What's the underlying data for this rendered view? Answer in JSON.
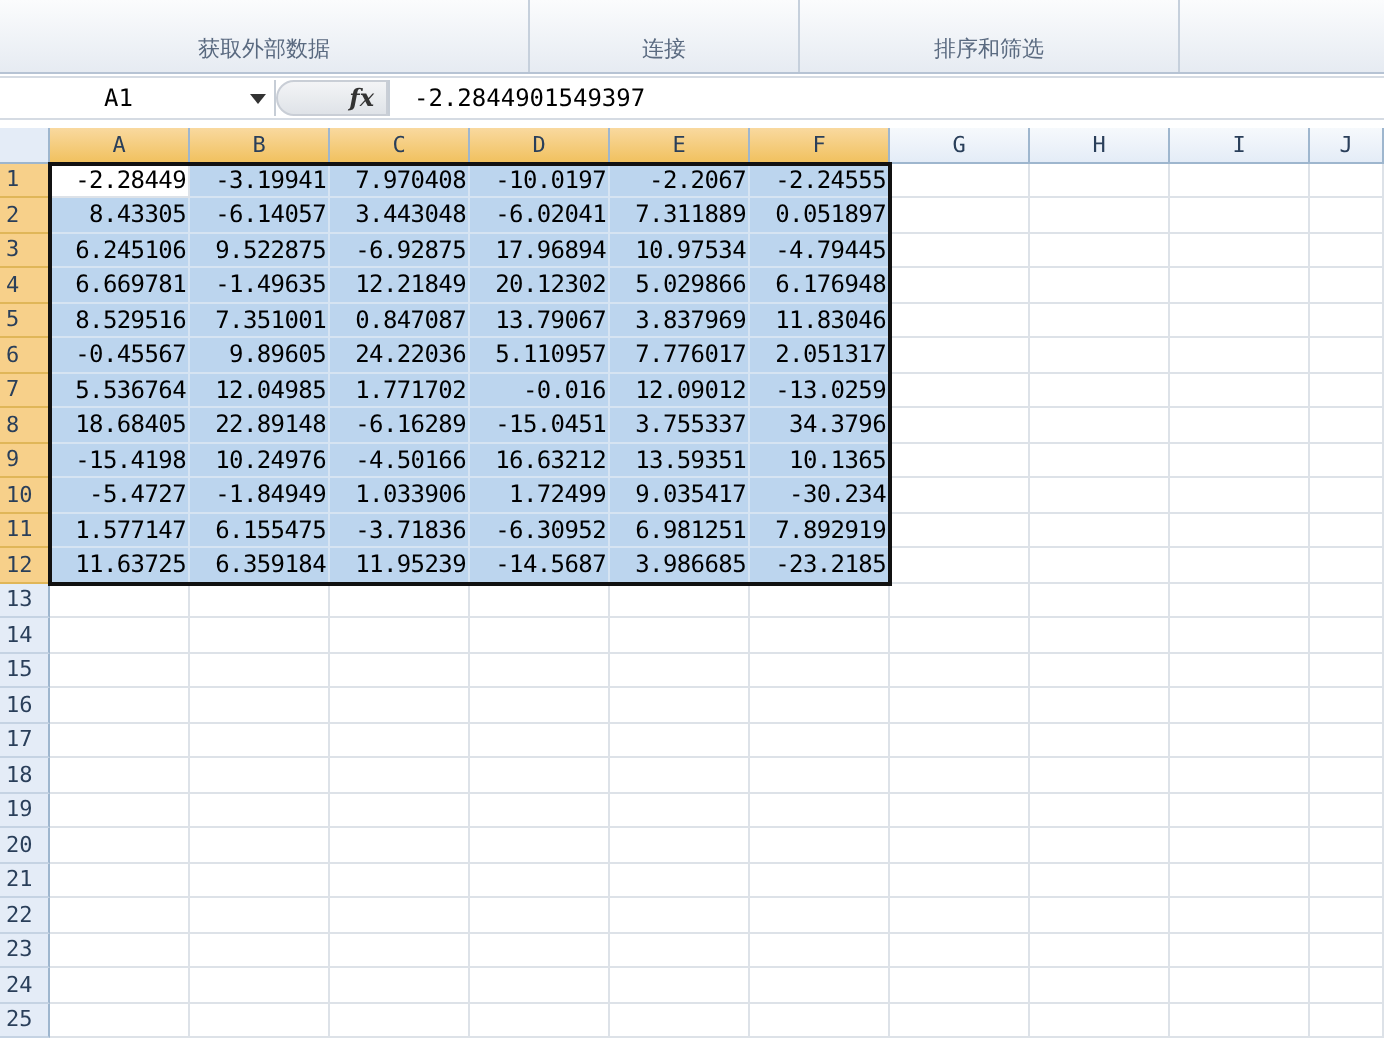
{
  "ribbon": {
    "groups": [
      {
        "label": "获取外部数据"
      },
      {
        "label": "连接"
      },
      {
        "label": "排序和筛选"
      }
    ]
  },
  "formula_bar": {
    "name_box": "A1",
    "function_button": "fx",
    "formula": "-2.2844901549397"
  },
  "columns": [
    {
      "label": "A",
      "selected": true
    },
    {
      "label": "B",
      "selected": true
    },
    {
      "label": "C",
      "selected": true
    },
    {
      "label": "D",
      "selected": true
    },
    {
      "label": "E",
      "selected": true
    },
    {
      "label": "F",
      "selected": true
    },
    {
      "label": "G",
      "selected": false
    },
    {
      "label": "H",
      "selected": false
    },
    {
      "label": "I",
      "selected": false
    },
    {
      "label": "J",
      "selected": false
    }
  ],
  "rows": [
    {
      "label": "1",
      "selected": true,
      "cells": [
        {
          "text": "-2.28449",
          "active": true
        },
        {
          "text": "-3.19941",
          "active": false
        },
        {
          "text": "7.970408",
          "active": false
        },
        {
          "text": "-10.0197",
          "active": false
        },
        {
          "text": "-2.2067",
          "active": false
        },
        {
          "text": "-2.24555",
          "active": false
        }
      ]
    },
    {
      "label": "2",
      "selected": true,
      "cells": [
        {
          "text": "8.43305",
          "active": false
        },
        {
          "text": "-6.14057",
          "active": false
        },
        {
          "text": "3.443048",
          "active": false
        },
        {
          "text": "-6.02041",
          "active": false
        },
        {
          "text": "7.311889",
          "active": false
        },
        {
          "text": "0.051897",
          "active": false
        }
      ]
    },
    {
      "label": "3",
      "selected": true,
      "cells": [
        {
          "text": "6.245106",
          "active": false
        },
        {
          "text": "9.522875",
          "active": false
        },
        {
          "text": "-6.92875",
          "active": false
        },
        {
          "text": "17.96894",
          "active": false
        },
        {
          "text": "10.97534",
          "active": false
        },
        {
          "text": "-4.79445",
          "active": false
        }
      ]
    },
    {
      "label": "4",
      "selected": true,
      "cells": [
        {
          "text": "6.669781",
          "active": false
        },
        {
          "text": "-1.49635",
          "active": false
        },
        {
          "text": "12.21849",
          "active": false
        },
        {
          "text": "20.12302",
          "active": false
        },
        {
          "text": "5.029866",
          "active": false
        },
        {
          "text": "6.176948",
          "active": false
        }
      ]
    },
    {
      "label": "5",
      "selected": true,
      "cells": [
        {
          "text": "8.529516",
          "active": false
        },
        {
          "text": "7.351001",
          "active": false
        },
        {
          "text": "0.847087",
          "active": false
        },
        {
          "text": "13.79067",
          "active": false
        },
        {
          "text": "3.837969",
          "active": false
        },
        {
          "text": "11.83046",
          "active": false
        }
      ]
    },
    {
      "label": "6",
      "selected": true,
      "cells": [
        {
          "text": "-0.45567",
          "active": false
        },
        {
          "text": "9.89605",
          "active": false
        },
        {
          "text": "24.22036",
          "active": false
        },
        {
          "text": "5.110957",
          "active": false
        },
        {
          "text": "7.776017",
          "active": false
        },
        {
          "text": "2.051317",
          "active": false
        }
      ]
    },
    {
      "label": "7",
      "selected": true,
      "cells": [
        {
          "text": "5.536764",
          "active": false
        },
        {
          "text": "12.04985",
          "active": false
        },
        {
          "text": "1.771702",
          "active": false
        },
        {
          "text": "-0.016",
          "active": false
        },
        {
          "text": "12.09012",
          "active": false
        },
        {
          "text": "-13.0259",
          "active": false
        }
      ]
    },
    {
      "label": "8",
      "selected": true,
      "cells": [
        {
          "text": "18.68405",
          "active": false
        },
        {
          "text": "22.89148",
          "active": false
        },
        {
          "text": "-6.16289",
          "active": false
        },
        {
          "text": "-15.0451",
          "active": false
        },
        {
          "text": "3.755337",
          "active": false
        },
        {
          "text": "34.3796",
          "active": false
        }
      ]
    },
    {
      "label": "9",
      "selected": true,
      "cells": [
        {
          "text": "-15.4198",
          "active": false
        },
        {
          "text": "10.24976",
          "active": false
        },
        {
          "text": "-4.50166",
          "active": false
        },
        {
          "text": "16.63212",
          "active": false
        },
        {
          "text": "13.59351",
          "active": false
        },
        {
          "text": "10.1365",
          "active": false
        }
      ]
    },
    {
      "label": "10",
      "selected": true,
      "cells": [
        {
          "text": "-5.4727",
          "active": false
        },
        {
          "text": "-1.84949",
          "active": false
        },
        {
          "text": "1.033906",
          "active": false
        },
        {
          "text": "1.72499",
          "active": false
        },
        {
          "text": "9.035417",
          "active": false
        },
        {
          "text": "-30.234",
          "active": false
        }
      ]
    },
    {
      "label": "11",
      "selected": true,
      "cells": [
        {
          "text": "1.577147",
          "active": false
        },
        {
          "text": "6.155475",
          "active": false
        },
        {
          "text": "-3.71836",
          "active": false
        },
        {
          "text": "-6.30952",
          "active": false
        },
        {
          "text": "6.981251",
          "active": false
        },
        {
          "text": "7.892919",
          "active": false
        }
      ]
    },
    {
      "label": "12",
      "selected": true,
      "cells": [
        {
          "text": "11.63725",
          "active": false
        },
        {
          "text": "6.359184",
          "active": false
        },
        {
          "text": "11.95239",
          "active": false
        },
        {
          "text": "-14.5687",
          "active": false
        },
        {
          "text": "3.986685",
          "active": false
        },
        {
          "text": "-23.2185",
          "active": false
        }
      ]
    },
    {
      "label": "13",
      "selected": false,
      "cells": []
    },
    {
      "label": "14",
      "selected": false,
      "cells": []
    },
    {
      "label": "15",
      "selected": false,
      "cells": []
    },
    {
      "label": "16",
      "selected": false,
      "cells": []
    },
    {
      "label": "17",
      "selected": false,
      "cells": []
    },
    {
      "label": "18",
      "selected": false,
      "cells": []
    },
    {
      "label": "19",
      "selected": false,
      "cells": []
    },
    {
      "label": "20",
      "selected": false,
      "cells": []
    },
    {
      "label": "21",
      "selected": false,
      "cells": []
    },
    {
      "label": "22",
      "selected": false,
      "cells": []
    },
    {
      "label": "23",
      "selected": false,
      "cells": []
    },
    {
      "label": "24",
      "selected": false,
      "cells": []
    },
    {
      "label": "25",
      "selected": false,
      "cells": []
    }
  ]
}
